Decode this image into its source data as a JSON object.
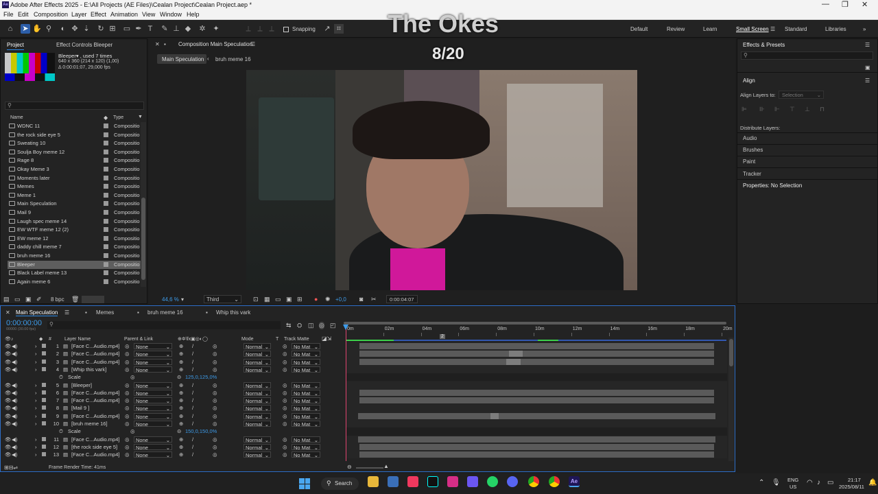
{
  "window": {
    "title": "Adobe After Effects 2025 - E:\\All Projects (AE Files)\\Cealan Project\\Cealan Project.aep *",
    "min": "—",
    "max": "❐",
    "close": "✕"
  },
  "menu": [
    "File",
    "Edit",
    "Composition",
    "Layer",
    "Effect",
    "Animation",
    "View",
    "Window",
    "Help"
  ],
  "toolbar": {
    "snapping": "Snapping",
    "workspaces": [
      "Default",
      "Review",
      "Learn",
      "Small Screen",
      "Standard",
      "Libraries"
    ],
    "more": "»"
  },
  "overlay": {
    "title": "The Okes",
    "counter": "8/20"
  },
  "project": {
    "tabs": [
      "Project",
      "Effect Controls Bleeper"
    ],
    "selected_name": "Bleeper▾ , used 7 times",
    "selected_info1": "640 x 360  (214 x 120) (1,00)",
    "selected_info2": "Δ 0:00:01:07, 29,000 fps",
    "search_placeholder": "",
    "col_name": "Name",
    "col_type": "Type",
    "items": [
      {
        "name": "WDNC 11",
        "type": "Compositio"
      },
      {
        "name": "the rock side eye 5",
        "type": "Compositio"
      },
      {
        "name": "Sweating 10",
        "type": "Compositio"
      },
      {
        "name": "Soulja Boy meme 12",
        "type": "Compositio"
      },
      {
        "name": "Rage 8",
        "type": "Compositio"
      },
      {
        "name": "Okay Meme 3",
        "type": "Compositio"
      },
      {
        "name": "Moments later",
        "type": "Compositio"
      },
      {
        "name": "Memes",
        "type": "Compositio"
      },
      {
        "name": "Meme 1",
        "type": "Compositio"
      },
      {
        "name": "Main Speculation",
        "type": "Compositio"
      },
      {
        "name": "Mail 9",
        "type": "Compositio"
      },
      {
        "name": "Laugh spec meme 14",
        "type": "Compositio"
      },
      {
        "name": "EW WTF meme 12 (2)",
        "type": "Compositio"
      },
      {
        "name": "EW meme 12",
        "type": "Compositio"
      },
      {
        "name": "daddy chill meme 7",
        "type": "Compositio"
      },
      {
        "name": "bruh meme 16",
        "type": "Compositio"
      },
      {
        "name": "Bleeper",
        "type": "Compositio"
      },
      {
        "name": "Black Label meme 13",
        "type": "Compositio"
      },
      {
        "name": "Again meme 6",
        "type": "Compositio"
      }
    ],
    "selected_index": 16,
    "bpc": "8 bpc"
  },
  "composition": {
    "tab": "Composition Main Speculation",
    "breadcrumbs": [
      "Main Speculation",
      "bruh meme 16"
    ],
    "zoom": "44,6 %",
    "resolution": "Third",
    "exposure": "+0,0",
    "timecode": "0:00:04:07"
  },
  "right": {
    "effects_title": "Effects & Presets",
    "search_placeholder": "",
    "align_title": "Align",
    "align_to_label": "Align Layers to:",
    "align_to_value": "Selection",
    "distribute": "Distribute Layers:",
    "sections": [
      "Audio",
      "Brushes",
      "Paint",
      "Tracker"
    ],
    "properties": "Properties: No Selection"
  },
  "timeline": {
    "tabs": [
      "Main Speculation",
      "Memes",
      "bruh meme 16",
      "Whip this vark"
    ],
    "timecode": "0:00:00:00",
    "timecode_sub": "00000 (30.00 fps)",
    "headers": {
      "num": "#",
      "layer": "Layer Name",
      "parent": "Parent & Link",
      "mode": "Mode",
      "t": "T",
      "matte": "Track Matte"
    },
    "ruler": [
      "0m",
      "02m",
      "04m",
      "06m",
      "08m",
      "10m",
      "12m",
      "14m",
      "16m",
      "18m",
      "20m"
    ],
    "rows": [
      {
        "num": "1",
        "name": "[Face C...Audio.mp4]",
        "parent": "None",
        "mode": "Normal",
        "matte": "No Mat"
      },
      {
        "num": "2",
        "name": "[Face C...Audio.mp4]",
        "parent": "None",
        "mode": "Normal",
        "matte": "No Mat"
      },
      {
        "num": "3",
        "name": "[Face C...Audio.mp4]",
        "parent": "None",
        "mode": "Normal",
        "matte": "No Mat"
      },
      {
        "num": "4",
        "name": "[Whip this vark]",
        "parent": "None",
        "mode": "Normal",
        "matte": "No Mat"
      },
      {
        "prop": "Scale",
        "value": "125,0,125,0%"
      },
      {
        "num": "5",
        "name": "[Bleeper]",
        "parent": "None",
        "mode": "Normal",
        "matte": "No Mat"
      },
      {
        "num": "6",
        "name": "[Face C...Audio.mp4]",
        "parent": "None",
        "mode": "Normal",
        "matte": "No Mat"
      },
      {
        "num": "7",
        "name": "[Face C...Audio.mp4]",
        "parent": "None",
        "mode": "Normal",
        "matte": "No Mat"
      },
      {
        "num": "8",
        "name": "[Mail 9 ]",
        "parent": "None",
        "mode": "Normal",
        "matte": "No Mat"
      },
      {
        "num": "9",
        "name": "[Face C...Audio.mp4]",
        "parent": "None",
        "mode": "Normal",
        "matte": "No Mat"
      },
      {
        "num": "10",
        "name": "[bruh meme 16]",
        "parent": "None",
        "mode": "Normal",
        "matte": "No Mat"
      },
      {
        "prop": "Scale",
        "value": "150,0,150,0%"
      },
      {
        "num": "11",
        "name": "[Face C...Audio.mp4]",
        "parent": "None",
        "mode": "Normal",
        "matte": "No Mat"
      },
      {
        "num": "12",
        "name": "[the rock side eye 5]",
        "parent": "None",
        "mode": "Normal",
        "matte": "No Mat"
      },
      {
        "num": "13",
        "name": "[Face C...Audio.mp4]",
        "parent": "None",
        "mode": "Normal",
        "matte": "No Mat"
      }
    ],
    "frame_render": "Frame Render Time:  41ms"
  },
  "taskbar": {
    "search": "Search",
    "lang": "ENG",
    "region": "US",
    "time": "21:17",
    "date": "2025/08/11"
  }
}
